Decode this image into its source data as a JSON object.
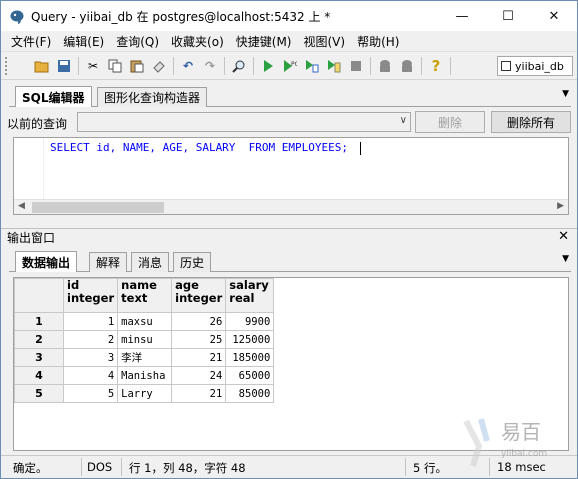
{
  "window": {
    "title": "Query - yiibai_db 在  postgres@localhost:5432 上 *",
    "controls": [
      "minimize-icon",
      "maximize-icon",
      "close-icon"
    ]
  },
  "menu": [
    "文件(F)",
    "编辑(E)",
    "查询(Q)",
    "收藏夹(o)",
    "快捷键(M)",
    "视图(V)",
    "帮助(H)"
  ],
  "toolbar": {
    "icons": [
      "open-folder-icon",
      "save-icon",
      "cut-icon",
      "copy-icon",
      "paste-icon",
      "eraser-icon",
      "undo-icon",
      "redo-icon",
      "find-icon",
      "execute-icon",
      "execute-pgscript-icon",
      "execute-to-file-icon",
      "explain-icon",
      "stop-icon",
      "commit-icon",
      "rollback-icon",
      "help-icon"
    ],
    "database": "yiibai_db"
  },
  "editor": {
    "tabs": [
      "SQL编辑器",
      "图形化查询构造器"
    ],
    "history_label": "以前的查询",
    "history_value": "",
    "delete_button": "删除",
    "delete_all_button": "删除所有",
    "sql": "SELECT id, NAME, AGE, SALARY  FROM EMPLOYEES;"
  },
  "output": {
    "title": "输出窗口",
    "tabs": [
      "数据输出",
      "解释",
      "消息",
      "历史"
    ],
    "columns": [
      {
        "name": "id",
        "type": "integer"
      },
      {
        "name": "name",
        "type": "text"
      },
      {
        "name": "age",
        "type": "integer"
      },
      {
        "name": "salary",
        "type": "real"
      }
    ],
    "rows": [
      {
        "n": "1",
        "id": "1",
        "name": "maxsu",
        "age": "26",
        "salary": "9900"
      },
      {
        "n": "2",
        "id": "2",
        "name": "minsu",
        "age": "25",
        "salary": "125000"
      },
      {
        "n": "3",
        "id": "3",
        "name": "李洋",
        "age": "21",
        "salary": "185000"
      },
      {
        "n": "4",
        "id": "4",
        "name": "Manisha",
        "age": "24",
        "salary": "65000"
      },
      {
        "n": "5",
        "id": "5",
        "name": "Larry",
        "age": "21",
        "salary": "85000"
      }
    ]
  },
  "status": {
    "state": "确定。",
    "encoding": "DOS",
    "position": "行 1，列 48，字符 48",
    "row_count": "5 行。",
    "time": "18 msec"
  },
  "watermark": {
    "brand": "易百",
    "url": "yiibai.com"
  },
  "colors": {
    "sql_keyword": "#0000ff",
    "window_border": "#6a8fb5",
    "chrome_bg": "#f0f0f0"
  }
}
